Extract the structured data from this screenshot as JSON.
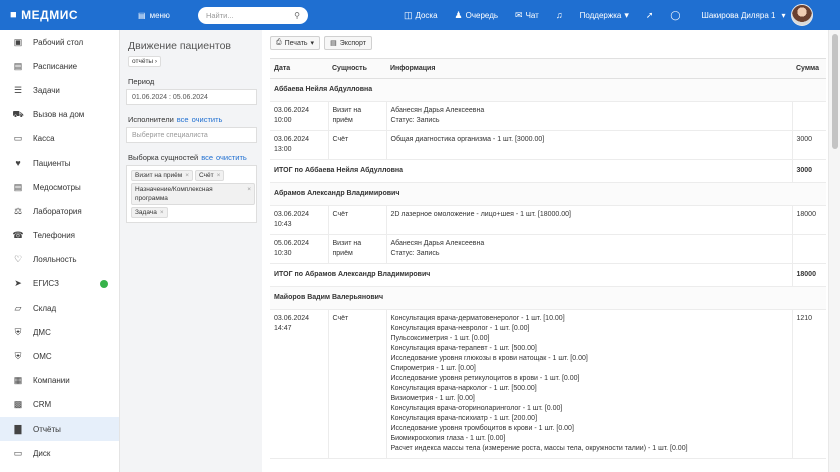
{
  "header": {
    "logo": "МЕДМИС",
    "menu_label": "меню",
    "search_placeholder": "Найти...",
    "nav": [
      {
        "label": "Доска",
        "icon": "board-icon"
      },
      {
        "label": "Очередь",
        "icon": "queue-icon"
      },
      {
        "label": "Чат",
        "icon": "chat-icon"
      },
      {
        "label": "",
        "icon": "bell-icon"
      },
      {
        "label": "Поддержка",
        "icon": "chevron-down-icon"
      },
      {
        "label": "",
        "icon": "pin-icon"
      },
      {
        "label": "",
        "icon": "bulb-icon"
      }
    ],
    "user_name": "Шакирова Диляра 1"
  },
  "sidebar": {
    "items": [
      {
        "label": "Рабочий стол"
      },
      {
        "label": "Расписание"
      },
      {
        "label": "Задачи"
      },
      {
        "label": "Вызов на дом"
      },
      {
        "label": "Касса"
      },
      {
        "label": "Пациенты"
      },
      {
        "label": "Медосмотры"
      },
      {
        "label": "Лаборатория"
      },
      {
        "label": "Телефония"
      },
      {
        "label": "Лояльность"
      },
      {
        "label": "ЕГИСЗ"
      },
      {
        "label": "Склад"
      },
      {
        "label": "ДМС"
      },
      {
        "label": "ОМС"
      },
      {
        "label": "Компании"
      },
      {
        "label": "CRM"
      },
      {
        "label": "Отчёты"
      },
      {
        "label": "Диск"
      }
    ],
    "egisz_status_color": "#36b24a"
  },
  "filters": {
    "title": "Движение пациентов",
    "tag": "отчёты",
    "period_label": "Период",
    "period_value": "01.06.2024 : 05.06.2024",
    "executors_label": "Исполнители",
    "all_link": "все",
    "clear_link": "очистить",
    "executors_placeholder": "Выберите специалиста",
    "entities_label": "Выборка сущностей",
    "chips": [
      "Визит на приём",
      "Счёт",
      "Назначение/Комплексная программа",
      "Задача"
    ]
  },
  "toolbar": {
    "print_label": "Печать",
    "export_label": "Экспорт"
  },
  "table": {
    "headers": [
      "Дата",
      "Сущность",
      "Информация",
      "Сумма"
    ],
    "groups": [
      {
        "name": "Аббаева Нейля Абдулловна",
        "rows": [
          {
            "date": "03.06.2024",
            "time": "10:00",
            "entity": "Визит на приём",
            "info": [
              "Абанесян Дарья Алексеевна",
              "Статус: Запись"
            ],
            "sum": ""
          },
          {
            "date": "03.06.2024",
            "time": "13:00",
            "entity": "Счёт",
            "info": [
              "Общая диагностика организма - 1 шт. [3000.00]"
            ],
            "sum": "3000"
          }
        ],
        "total_label": "ИТОГ по Аббаева Нейля Абдулловна",
        "total": "3000"
      },
      {
        "name": "Абрамов Александр Владимирович",
        "rows": [
          {
            "date": "03.06.2024",
            "time": "10:43",
            "entity": "Счёт",
            "info": [
              "2D лазерное омоложение - лицо+шея - 1 шт. [18000.00]"
            ],
            "sum": "18000"
          },
          {
            "date": "05.06.2024",
            "time": "10:30",
            "entity": "Визит на приём",
            "info": [
              "Абанесян Дарья Алексеевна",
              "Статус: Запись"
            ],
            "sum": ""
          }
        ],
        "total_label": "ИТОГ по Абрамов Александр Владимирович",
        "total": "18000"
      },
      {
        "name": "Майоров Вадим Валерьянович",
        "rows": [
          {
            "date": "03.06.2024",
            "time": "14:47",
            "entity": "Счёт",
            "info": [
              "Консультация врача-дерматовенеролог - 1 шт. [10.00]",
              "Консультация врача-невролог - 1 шт. [0.00]",
              "Пульсоксиметрия - 1 шт. [0.00]",
              "Консультация врача-терапевт - 1 шт. [500.00]",
              "Исследование уровня глюкозы в крови натощак - 1 шт. [0.00]",
              "Спирометрия - 1 шт. [0.00]",
              "Исследование уровня ретикулоцитов в крови - 1 шт. [0.00]",
              "Консультация врача-нарколог - 1 шт. [500.00]",
              "Визиометрия - 1 шт. [0.00]",
              "Консультация врача-оториноларинголог - 1 шт. [0.00]",
              "Консультация врача-психиатр - 1 шт. [200.00]",
              "Исследование уровня тромбоцитов в крови - 1 шт. [0.00]",
              "Биомикроскопия глаза - 1 шт. [0.00]",
              "Расчет индекса массы тела (измерение роста, массы тела, окружности талии) - 1 шт. [0.00]"
            ],
            "sum": "1210"
          }
        ]
      }
    ]
  }
}
